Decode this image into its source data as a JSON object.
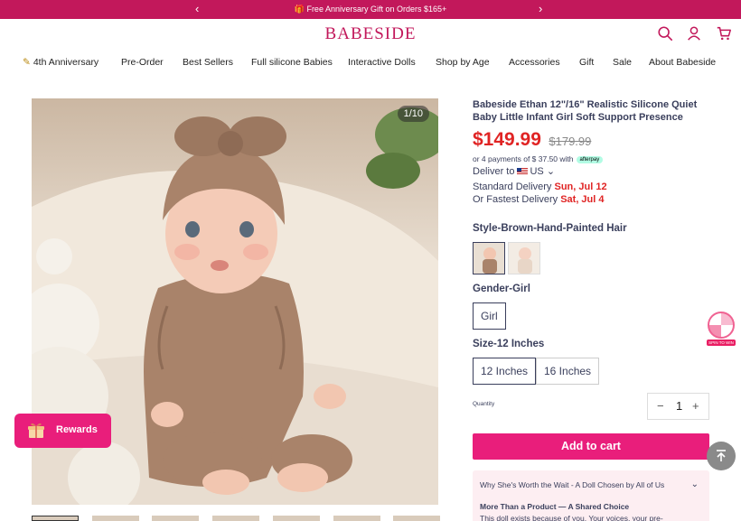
{
  "promo": {
    "text": "🎁 Free Anniversary Gift on Orders $165+",
    "prev": "‹",
    "next": "›"
  },
  "header": {
    "logo": "BABESIDE"
  },
  "nav": {
    "items": [
      {
        "label": "4th Anniversary",
        "icon": "✎"
      },
      {
        "label": "Pre-Order"
      },
      {
        "label": "Best Sellers"
      },
      {
        "label": "Full silicone Babies"
      },
      {
        "label": "Interactive Dolls"
      },
      {
        "label": "Shop by Age"
      },
      {
        "label": "Accessories"
      },
      {
        "label": "Gift"
      },
      {
        "label": "Sale"
      },
      {
        "label": "About Babeside"
      }
    ]
  },
  "gallery": {
    "counter": "1/10",
    "thumbnail_count": 7,
    "active_index": 0
  },
  "product": {
    "title": "Babeside Ethan 12\"/16\" Realistic Silicone Quiet Baby Little Infant Girl Soft Support Presence",
    "price": "$149.99",
    "compare_price": "$179.99",
    "installments": "or 4 payments of $ 37.50 with",
    "afterpay": "afterpay",
    "deliver_to": "Deliver to",
    "country": "US",
    "standard_label": "Standard Delivery",
    "standard_date": "Sun, Jul 12",
    "fastest_label": "Or Fastest Delivery",
    "fastest_date": "Sat, Jul 4",
    "style_label": "Style-Brown-Hand-Painted Hair",
    "gender_label": "Gender-Girl",
    "gender_options": [
      "Girl"
    ],
    "size_label": "Size-12 Inches",
    "size_options": [
      "12 Inches",
      "16 Inches"
    ],
    "quantity_label": "Quantity",
    "quantity": "1",
    "minus": "−",
    "plus": "+",
    "add_to_cart": "Add to cart"
  },
  "accordion": {
    "heading": "Why She's Worth the Wait - A Doll Chosen by All of Us",
    "chevron": "⌄",
    "subheading": "More Than a Product — A Shared Choice",
    "body": "This doll exists because of you. Your voices, your pre-"
  },
  "rewards": {
    "label": "Rewards"
  },
  "spin": {
    "label": "SPIN TO WIN"
  },
  "colors": {
    "brand": "#c2185b",
    "cta": "#e91e7b",
    "price": "#e02424",
    "text": "#3a3f5c"
  }
}
